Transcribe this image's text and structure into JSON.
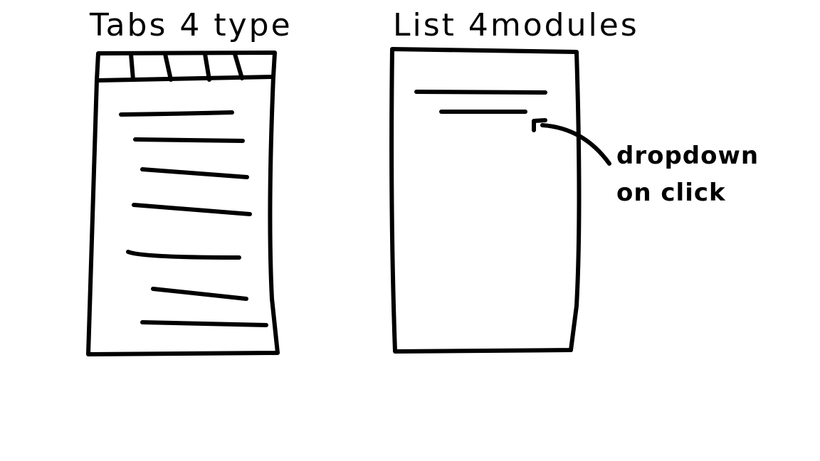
{
  "left_panel": {
    "title": "Tabs 4 type",
    "tab_count": 5,
    "list_line_count": 7
  },
  "right_panel": {
    "title": "List 4modules",
    "list_line_count": 2
  },
  "annotation": {
    "line1": "dropdown",
    "line2": "on click"
  }
}
